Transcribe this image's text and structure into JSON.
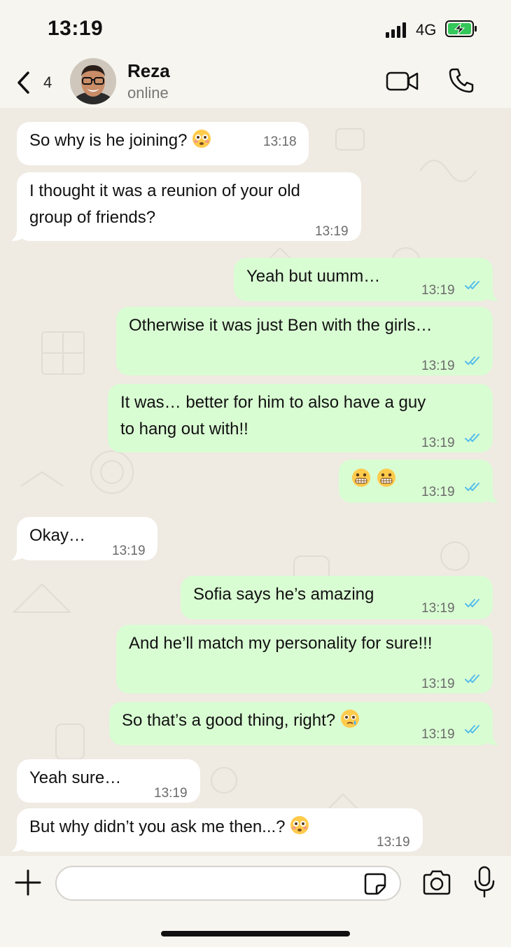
{
  "status_bar": {
    "time": "13:19",
    "network": "4G",
    "signal_icon": "signal-bars-icon",
    "battery_icon": "battery-charging-icon",
    "battery_color": "#34c759"
  },
  "header": {
    "back_icon": "chevron-left-icon",
    "unread_count": "4",
    "contact_name": "Reza",
    "contact_status": "online",
    "video_icon": "video-camera-icon",
    "call_icon": "phone-icon"
  },
  "colors": {
    "incoming_bubble": "#ffffff",
    "outgoing_bubble": "#d9fdd3",
    "read_check": "#53bdeb",
    "wallpaper": "#efeae2"
  },
  "messages": [
    {
      "direction": "in",
      "text": "So why is he joining? ",
      "emoji": "flushed-face-icon",
      "time": "13:18"
    },
    {
      "direction": "in",
      "text": "I thought it was a reunion of your old\ngroup of friends?",
      "time": "13:19"
    },
    {
      "direction": "out",
      "text": "Yeah but uumm…",
      "time": "13:19",
      "read": true
    },
    {
      "direction": "out",
      "text": "Otherwise it was just Ben with the girls…",
      "time": "13:19",
      "read": true
    },
    {
      "direction": "out",
      "text": "It was… better for him to also have a guy\nto hang out with!!",
      "time": "13:19",
      "read": true
    },
    {
      "direction": "out",
      "text": "",
      "emoji": "grimacing-face-icon",
      "time": "13:19",
      "read": true
    },
    {
      "direction": "in",
      "text": "Okay…",
      "time": "13:19"
    },
    {
      "direction": "out",
      "text": "Sofia says he’s amazing",
      "time": "13:19",
      "read": true
    },
    {
      "direction": "out",
      "text": "And he’ll match my personality for sure!!!",
      "time": "13:19",
      "read": true
    },
    {
      "direction": "out",
      "text": "So that’s a good thing, right? ",
      "emoji": "face-holding-back-tears-icon",
      "time": "13:19",
      "read": true
    },
    {
      "direction": "in",
      "text": "Yeah sure…",
      "time": "13:19"
    },
    {
      "direction": "in",
      "text": "But why didn’t you ask me then...? ",
      "emoji": "flushed-face-icon",
      "time": "13:19"
    }
  ],
  "input_bar": {
    "plus_icon": "plus-icon",
    "placeholder": "",
    "sticker_icon": "sticker-icon",
    "camera_icon": "camera-icon",
    "mic_icon": "microphone-icon"
  }
}
